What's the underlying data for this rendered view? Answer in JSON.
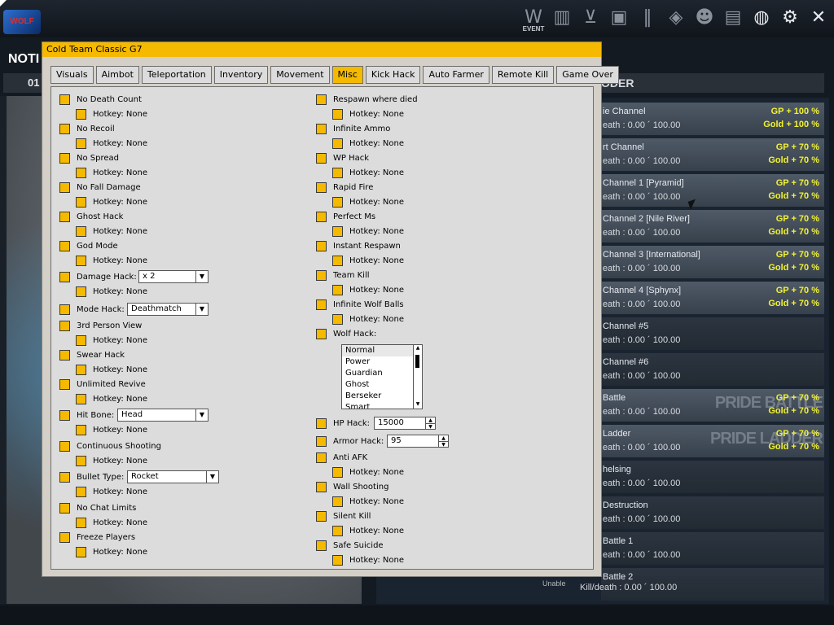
{
  "trainer": {
    "title": "Cold Team Classic G7",
    "tabs": [
      "Visuals",
      "Aimbot",
      "Teleportation",
      "Inventory",
      "Movement",
      "Misc",
      "Kick Hack",
      "Auto Farmer",
      "Remote Kill",
      "Game Over"
    ],
    "active_tab": "Misc",
    "hotkey_text": "Hotkey: None",
    "left_options": [
      {
        "label": "No Death Count",
        "hotkey": "Hotkey: None"
      },
      {
        "label": "No Recoil",
        "hotkey": "Hotkey: None"
      },
      {
        "label": "No Spread",
        "hotkey": "Hotkey: None"
      },
      {
        "label": "No Fall Damage",
        "hotkey": "Hotkey: None"
      },
      {
        "label": "Ghost Hack",
        "hotkey": "Hotkey: None"
      },
      {
        "label": "God Mode",
        "hotkey": "Hotkey: None"
      },
      {
        "label": "Damage Hack:",
        "hotkey": "Hotkey: None",
        "combo": "x 2"
      },
      {
        "label": "Mode Hack:",
        "combo": "Deathmatch"
      },
      {
        "label": "3rd Person View",
        "hotkey": "Hotkey: None"
      },
      {
        "label": "Swear Hack",
        "hotkey": "Hotkey: None"
      },
      {
        "label": "Unlimited Revive",
        "hotkey": "Hotkey: None"
      },
      {
        "label": "Hit Bone:",
        "hotkey": "Hotkey: None",
        "combo": "Head"
      },
      {
        "label": "Continuous Shooting",
        "hotkey": "Hotkey: None"
      },
      {
        "label": "Bullet Type:",
        "hotkey": "Hotkey: None",
        "combo": "Rocket"
      },
      {
        "label": "No Chat Limits",
        "hotkey": "Hotkey: None"
      },
      {
        "label": "Freeze Players",
        "hotkey": "Hotkey: None"
      }
    ],
    "right_options": [
      {
        "label": "Respawn where died",
        "hotkey": "Hotkey: None"
      },
      {
        "label": "Infinite Ammo",
        "hotkey": "Hotkey: None"
      },
      {
        "label": "WP Hack",
        "hotkey": "Hotkey: None"
      },
      {
        "label": "Rapid Fire",
        "hotkey": "Hotkey: None"
      },
      {
        "label": "Perfect Ms",
        "hotkey": "Hotkey: None"
      },
      {
        "label": "Instant Respawn",
        "hotkey": "Hotkey: None"
      },
      {
        "label": "Team Kill",
        "hotkey": "Hotkey: None"
      },
      {
        "label": "Infinite Wolf Balls",
        "hotkey": "Hotkey: None"
      },
      {
        "label": "Wolf Hack:"
      }
    ],
    "wolf_list": [
      "Normal",
      "Power",
      "Guardian",
      "Ghost",
      "Berseker",
      "Smart"
    ],
    "hp_hack": {
      "label": "HP Hack:",
      "value": "15000"
    },
    "armor_hack": {
      "label": "Armor Hack:",
      "value": "95"
    },
    "right_options_2": [
      {
        "label": "Anti AFK",
        "hotkey": "Hotkey: None"
      },
      {
        "label": "Wall Shooting",
        "hotkey": "Hotkey: None"
      },
      {
        "label": "Silent Kill",
        "hotkey": "Hotkey: None"
      },
      {
        "label": "Safe Suicide",
        "hotkey": "Hotkey: None"
      }
    ]
  },
  "game": {
    "notice": "NOTI",
    "left_tab": "01",
    "decoder": "ODER",
    "top_icons": [
      "event-icon",
      "buildings-icon",
      "cart-icon",
      "briefcase-icon",
      "barcode-icon",
      "cube-icon",
      "users-icon",
      "chart-icon",
      "globe-icon",
      "gear-icon",
      "close-icon"
    ],
    "event_label": "EVENT",
    "unable": "Unable",
    "last_kd": "Kill/death : 0.00 ´ 100.00",
    "channels": [
      {
        "name": "ie Channel",
        "kd": "eath : 0.00 ´ 100.00",
        "gp": "GP + 100 %",
        "gold": "Gold + 100 %"
      },
      {
        "name": "rt Channel",
        "kd": "eath : 0.00 ´ 100.00",
        "gp": "GP + 70 %",
        "gold": "Gold + 70 %"
      },
      {
        "name": "Channel 1 [Pyramid]",
        "kd": "eath : 0.00 ´ 100.00",
        "gp": "GP + 70 %",
        "gold": "Gold + 70 %"
      },
      {
        "name": "Channel 2 [Nile River]",
        "kd": "eath : 0.00 ´ 100.00",
        "gp": "GP + 70 %",
        "gold": "Gold + 70 %"
      },
      {
        "name": "Channel 3 [International]",
        "kd": "eath : 0.00 ´ 100.00",
        "gp": "GP + 70 %",
        "gold": "Gold + 70 %"
      },
      {
        "name": "Channel 4 [Sphynx]",
        "kd": "eath : 0.00 ´ 100.00",
        "gp": "GP + 70 %",
        "gold": "Gold + 70 %"
      },
      {
        "name": "Channel #5",
        "kd": "eath : 0.00 ´ 100.00"
      },
      {
        "name": "Channel #6",
        "kd": "eath : 0.00 ´ 100.00"
      },
      {
        "name": "Battle",
        "kd": "eath : 0.00 ´ 100.00",
        "gp": "GP + 70 %",
        "gold": "Gold + 70 %",
        "wm": "PRIDE BATTLE"
      },
      {
        "name": "Ladder",
        "kd": "eath : 0.00 ´ 100.00",
        "gp": "GP + 70 %",
        "gold": "Gold + 70 %",
        "wm": "PRIDE LADDER"
      },
      {
        "name": "helsing",
        "kd": "eath : 0.00 ´ 100.00"
      },
      {
        "name": "Destruction",
        "kd": "eath : 0.00 ´ 100.00"
      },
      {
        "name": "Battle 1",
        "kd": "eath : 0.00 ´ 100.00"
      },
      {
        "name": "Battle 2"
      }
    ]
  }
}
